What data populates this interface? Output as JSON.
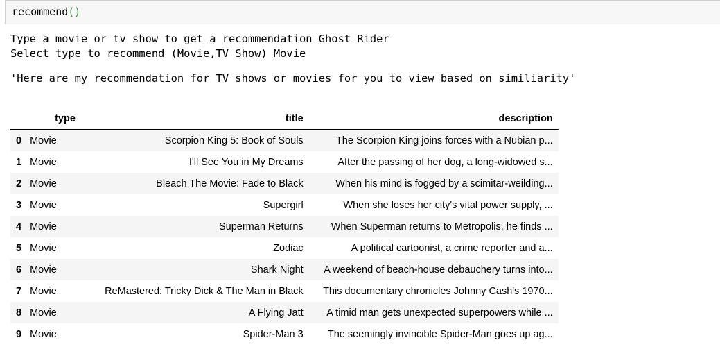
{
  "input_cell": {
    "code_name": "recommend",
    "code_parens": "()"
  },
  "stdout": {
    "lines": [
      "Type a movie or tv show to get a recommendation Ghost Rider",
      "Select type to recommend (Movie,TV Show) Movie"
    ]
  },
  "result_text": "'Here are my recommendation for TV shows or movies for you to view based on similiarity'",
  "table": {
    "columns": [
      "type",
      "title",
      "description"
    ],
    "rows": [
      {
        "index": "0",
        "type": "Movie",
        "title": "Scorpion King 5: Book of Souls",
        "description": "The Scorpion King joins forces with a Nubian p..."
      },
      {
        "index": "1",
        "type": "Movie",
        "title": "I'll See You in My Dreams",
        "description": "After the passing of her dog, a long-widowed s..."
      },
      {
        "index": "2",
        "type": "Movie",
        "title": "Bleach The Movie: Fade to Black",
        "description": "When his mind is fogged by a scimitar-weilding..."
      },
      {
        "index": "3",
        "type": "Movie",
        "title": "Supergirl",
        "description": "When she loses her city's vital power supply, ..."
      },
      {
        "index": "4",
        "type": "Movie",
        "title": "Superman Returns",
        "description": "When Superman returns to Metropolis, he finds ..."
      },
      {
        "index": "5",
        "type": "Movie",
        "title": "Zodiac",
        "description": "A political cartoonist, a crime reporter and a..."
      },
      {
        "index": "6",
        "type": "Movie",
        "title": "Shark Night",
        "description": "A weekend of beach-house debauchery turns into..."
      },
      {
        "index": "7",
        "type": "Movie",
        "title": "ReMastered: Tricky Dick & The Man in Black",
        "description": "This documentary chronicles Johnny Cash's 1970..."
      },
      {
        "index": "8",
        "type": "Movie",
        "title": "A Flying Jatt",
        "description": "A timid man gets unexpected superpowers while ..."
      },
      {
        "index": "9",
        "type": "Movie",
        "title": "Spider-Man 3",
        "description": "The seemingly invincible Spider-Man goes up ag..."
      }
    ]
  }
}
